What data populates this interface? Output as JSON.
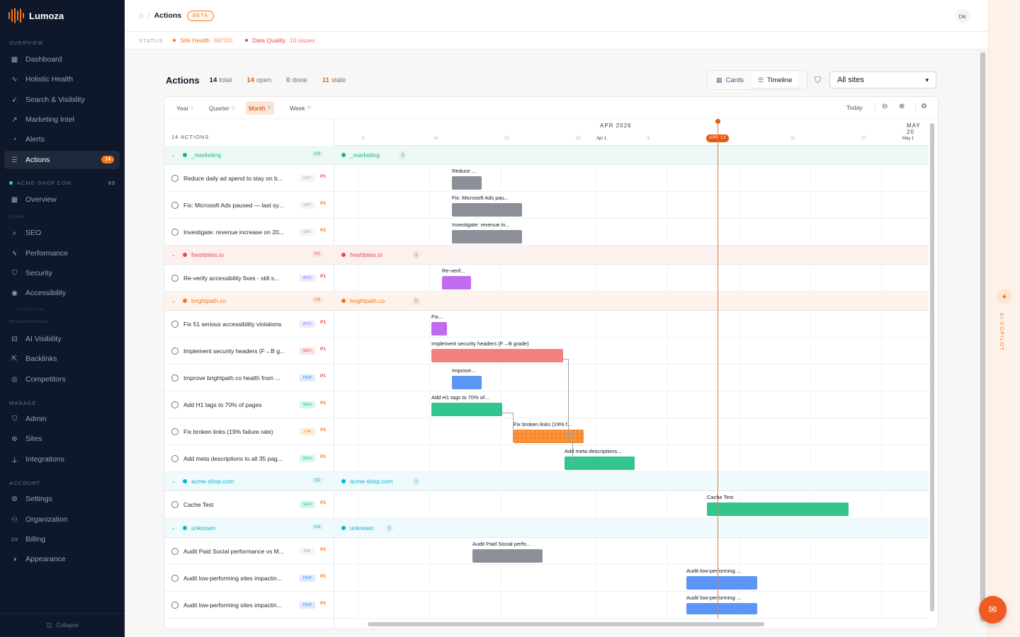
{
  "brand": {
    "name": "Lumoza"
  },
  "sidebar": {
    "sections": {
      "overview": "OVERVIEW",
      "core": "CORE",
      "technical": "TECHNICAL",
      "intelligence": "INTELLIGENCE",
      "manage": "MANAGE",
      "account": "ACCOUNT"
    },
    "overview_items": [
      {
        "label": "Dashboard",
        "icon": "dashboard-icon"
      },
      {
        "label": "Holistic Health",
        "icon": "pulse-icon"
      },
      {
        "label": "Search & Visibility",
        "icon": "rocket-icon"
      },
      {
        "label": "Marketing Intel",
        "icon": "trend-icon"
      },
      {
        "label": "Alerts",
        "icon": "bell-icon"
      },
      {
        "label": "Actions",
        "icon": "checklist-icon",
        "badge": "14"
      }
    ],
    "site": {
      "name": "ACME-SHOP.COM",
      "score": "89"
    },
    "site_items": [
      {
        "label": "Overview",
        "icon": "dashboard-icon"
      }
    ],
    "core_items": [
      {
        "label": "SEO",
        "icon": "search-icon"
      },
      {
        "label": "Performance",
        "icon": "bolt-icon"
      },
      {
        "label": "Security",
        "icon": "shield-icon"
      },
      {
        "label": "Accessibility",
        "icon": "eye-icon"
      }
    ],
    "technical_count": "7",
    "intelligence_items": [
      {
        "label": "AI Visibility",
        "icon": "robot-icon"
      },
      {
        "label": "Backlinks",
        "icon": "external-link-icon"
      },
      {
        "label": "Competitors",
        "icon": "target-icon"
      }
    ],
    "manage_items": [
      {
        "label": "Admin",
        "icon": "shield-icon"
      },
      {
        "label": "Sites",
        "icon": "globe-icon"
      },
      {
        "label": "Integrations",
        "icon": "plug-icon"
      }
    ],
    "account_items": [
      {
        "label": "Settings",
        "icon": "gear-icon"
      },
      {
        "label": "Organization",
        "icon": "users-icon"
      },
      {
        "label": "Billing",
        "icon": "card-icon"
      },
      {
        "label": "Appearance",
        "icon": "palette-icon"
      }
    ],
    "collapse_label": "Collapse"
  },
  "header": {
    "breadcrumb": "Actions",
    "beta": "BETA",
    "avatar": "DK"
  },
  "status": {
    "label": "STATUS",
    "site_health": {
      "label": "Site Health",
      "value": "68/100",
      "color": "#f97316"
    },
    "data_quality": {
      "label": "Data Quality",
      "value": "10 issues",
      "color": "#ef4444"
    }
  },
  "page": {
    "title": "Actions",
    "stats": [
      {
        "num": "14",
        "label": "total",
        "color": "#111827"
      },
      {
        "num": "14",
        "label": "open",
        "color": "#ea580c"
      },
      {
        "num": "0",
        "label": "done",
        "color": "#10b981"
      },
      {
        "num": "11",
        "label": "stale",
        "color": "#d97706"
      }
    ],
    "views": {
      "cards": "Cards",
      "timeline": "Timeline"
    },
    "site_select": "All sites"
  },
  "timeline": {
    "scales": [
      {
        "label": "Year",
        "key": "Y"
      },
      {
        "label": "Quarter",
        "key": "Q"
      },
      {
        "label": "Month",
        "key": "M"
      },
      {
        "label": "Week",
        "key": "W"
      }
    ],
    "today_label": "Today",
    "count_label": "14 ACTIONS",
    "months": [
      "APR 2026",
      "MAY 20"
    ],
    "weeks": [
      "9",
      "16",
      "23",
      "30",
      "Apr 1",
      "6",
      "20",
      "27",
      "May 1"
    ],
    "today_pill": "APR 13",
    "groups": [
      {
        "name": "_marketing",
        "count": "0/3",
        "num": "3",
        "color": "#10b981",
        "bg": "#eef9f7",
        "tasks": [
          {
            "title": "Reduce daily ad spend to stay on b...",
            "tag": "DAT",
            "priority": "P1",
            "bar_label": "Reduce ..."
          },
          {
            "title": "Fix: Microsoft Ads paused — last sy...",
            "tag": "DAT",
            "priority": "P2",
            "bar_label": "Fix: Microsoft Ads pau..."
          },
          {
            "title": "Investigate: revenue increase on 20...",
            "tag": "DAT",
            "priority": "P2",
            "bar_label": "Investigate: revenue in..."
          }
        ]
      },
      {
        "name": "freshbites.io",
        "count": "0/1",
        "num": "1",
        "color": "#ef4444",
        "bg": "#fdf1f0",
        "tasks": [
          {
            "title": "Re-verify accessibility fixes - still s...",
            "tag": "ACC",
            "priority": "P1",
            "bar_label": "Re-verif..."
          }
        ]
      },
      {
        "name": "brightpath.co",
        "count": "0/6",
        "num": "6",
        "color": "#f97316",
        "bg": "#fdf3ec",
        "tasks": [
          {
            "title": "Fix 51 serious accessibility violations",
            "tag": "ACC",
            "priority": "P1",
            "bar_label": "Fix..."
          },
          {
            "title": "Implement security headers (F→B g...",
            "tag": "SEC",
            "priority": "P1",
            "bar_label": "Implement security headers (F→B grade)"
          },
          {
            "title": "Improve brightpath.co health from ...",
            "tag": "PER",
            "priority": "P1",
            "bar_label": "Improve..."
          },
          {
            "title": "Add H1 tags to 70% of pages",
            "tag": "SEO",
            "priority": "P2",
            "bar_label": "Add H1 tags to 70% of..."
          },
          {
            "title": "Fix broken links (19% failure rate)",
            "tag": "LIN",
            "priority": "P2",
            "bar_label": "Fix broken links (19% f..."
          },
          {
            "title": "Add meta descriptions to all 35 pag...",
            "tag": "SEO",
            "priority": "P2",
            "bar_label": "Add meta descriptions..."
          }
        ]
      },
      {
        "name": "acme-shop.com",
        "count": "0/1",
        "num": "1",
        "color": "#06b6d4",
        "bg": "#eefafc",
        "tasks": [
          {
            "title": "Cache Test",
            "tag": "SEO",
            "priority": "P3",
            "bar_label": "Cache Test"
          }
        ]
      },
      {
        "name": "unknown",
        "count": "0/3",
        "num": "3",
        "color": "#06b6d4",
        "bg": "#eefafc",
        "tasks": [
          {
            "title": "Audit Paid Social performance vs M...",
            "tag": "PAI",
            "priority": "P2",
            "bar_label": "Audit Paid Social perfo..."
          },
          {
            "title": "Audit low-performing sites impactin...",
            "tag": "PER",
            "priority": "P2",
            "bar_label": "Audit low-performing ..."
          },
          {
            "title": "Audit low-performing sites impactin...",
            "tag": "PER",
            "priority": "P2",
            "bar_label": "Audit low-performing ..."
          }
        ]
      }
    ]
  },
  "copilot": {
    "label": "AI COPILOT"
  }
}
